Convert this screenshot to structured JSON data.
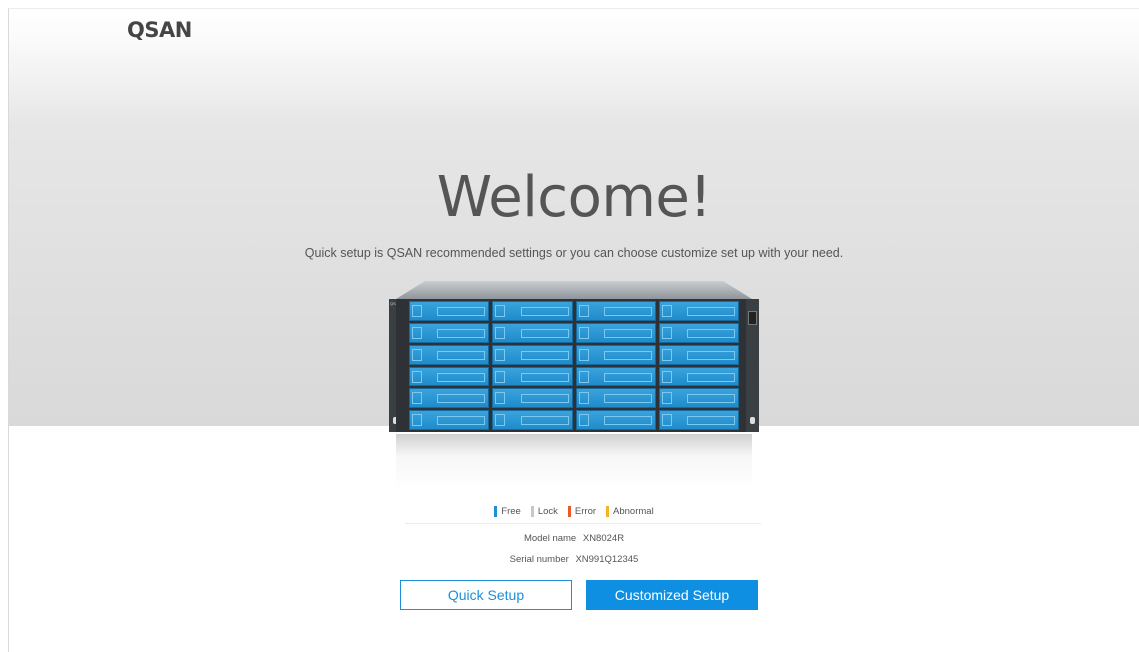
{
  "brand": {
    "logo_text": "QSAN"
  },
  "hero": {
    "title": "Welcome!",
    "subtitle": "Quick setup is QSAN recommended settings or you can choose customize set up with your need."
  },
  "device": {
    "model_icon_text": "QSAN",
    "bays": 24
  },
  "legend": [
    {
      "label": "Free",
      "color": "#1e90d6"
    },
    {
      "label": "Lock",
      "color": "#c8c8c8"
    },
    {
      "label": "Error",
      "color": "#e85a2a"
    },
    {
      "label": "Abnormal",
      "color": "#f2b52a"
    }
  ],
  "info": {
    "model_label": "Model name",
    "model_value": "XN8024R",
    "serial_label": "Serial number",
    "serial_value": "XN991Q12345"
  },
  "buttons": {
    "quick_label": "Quick Setup",
    "custom_label": "Customized Setup"
  },
  "colors": {
    "accent": "#0f8fe2",
    "bay_blue": "#2b98d6"
  }
}
